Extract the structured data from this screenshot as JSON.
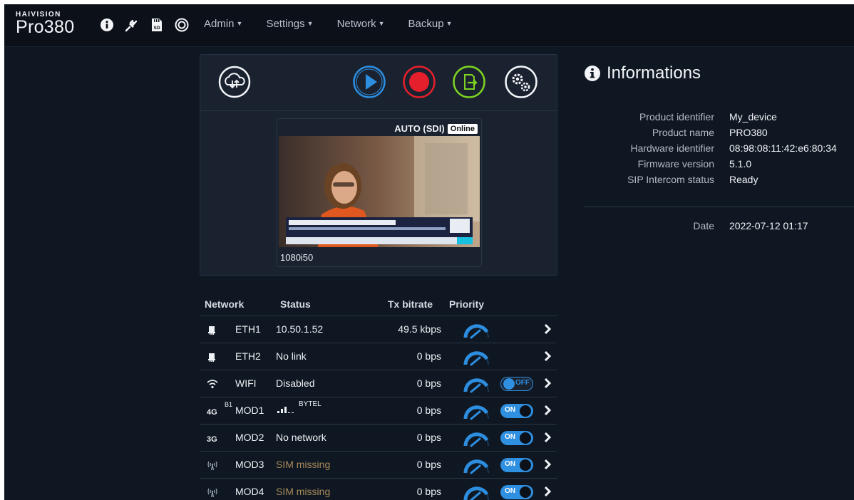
{
  "brand": {
    "company": "HAIVISION",
    "product": "Pro380"
  },
  "nav": {
    "icons": [
      "info-icon",
      "plug-icon",
      "sd-card-icon",
      "target-icon"
    ],
    "sd_label": "SD",
    "menus": [
      {
        "label": "Admin"
      },
      {
        "label": "Settings"
      },
      {
        "label": "Network"
      },
      {
        "label": "Backup"
      }
    ]
  },
  "toolbar": {
    "buttons": [
      "cloud-sync-icon",
      "play-icon",
      "record-icon",
      "export-icon",
      "settings-gears-icon"
    ],
    "colors": {
      "play": "#2d8ee0",
      "record": "#e51f2b",
      "export": "#7ed321",
      "white": "#f3f5f8"
    }
  },
  "video": {
    "mode": "AUTO (SDI)",
    "status": "Online",
    "resolution": "1080i50"
  },
  "network": {
    "headers": {
      "network": "Network",
      "status": "Status",
      "tx": "Tx bitrate",
      "priority": "Priority"
    },
    "rows": [
      {
        "icon": "ethernet-icon",
        "name": "ETH1",
        "status": "10.50.1.52",
        "tx": "49.5 kbps",
        "toggle": null
      },
      {
        "icon": "ethernet-icon",
        "name": "ETH2",
        "status": "No link",
        "tx": "0 bps",
        "toggle": null
      },
      {
        "icon": "wifi-icon",
        "name": "WIFI",
        "status": "Disabled",
        "tx": "0 bps",
        "toggle": "OFF"
      },
      {
        "icon": "4g-icon",
        "icon_text": "4G",
        "sup": "B1",
        "name": "MOD1",
        "status": "BYTEL",
        "tx": "0 bps",
        "toggle": "ON"
      },
      {
        "icon": "3g-icon",
        "icon_text": "3G",
        "name": "MOD2",
        "status": "No network",
        "tx": "0 bps",
        "toggle": "ON"
      },
      {
        "icon": "antenna-icon",
        "name": "MOD3",
        "status": "SIM missing",
        "status_warn": true,
        "tx": "0 bps",
        "toggle": "ON"
      },
      {
        "icon": "antenna-icon",
        "name": "MOD4",
        "status": "SIM missing",
        "status_warn": true,
        "tx": "0 bps",
        "toggle": "ON"
      }
    ]
  },
  "info": {
    "title": "Informations",
    "rows": [
      {
        "label": "Product identifier",
        "value": "My_device"
      },
      {
        "label": "Product name",
        "value": "PRO380"
      },
      {
        "label": "Hardware identifier",
        "value": "08:98:08:11:42:e6:80:34"
      },
      {
        "label": "Firmware version",
        "value": "5.1.0"
      },
      {
        "label": "SIP Intercom status",
        "value": "Ready"
      }
    ],
    "date_label": "Date",
    "date_value": "2022-07-12 01:17"
  },
  "accent": "#2d8ee0"
}
